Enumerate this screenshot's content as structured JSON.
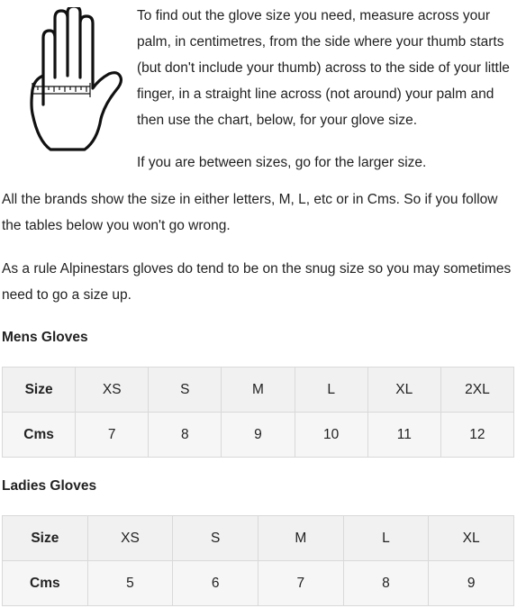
{
  "intro": {
    "paragraph1": "To find out the glove size you need, measure across your palm, in centimetres, from the side where your thumb starts (but don't include your thumb) across to the side of your little finger, in a straight line across (not around) your palm and then use the chart, below, for your glove size.",
    "paragraph2": "If you are between sizes, go for the larger size.",
    "icon": "hand-measure-icon"
  },
  "body": {
    "paragraph3": "All the brands show the size in either letters, M, L, etc or in Cms. So if you follow the tables below you won't go wrong.",
    "paragraph4": "As a rule Alpinestars gloves do tend to be on the snug size so you may sometimes need to go a size up."
  },
  "mens": {
    "heading": "Mens Gloves",
    "size_label": "Size",
    "cms_label": "Cms",
    "sizes": [
      "XS",
      "S",
      "M",
      "L",
      "XL",
      "2XL"
    ],
    "cms": [
      "7",
      "8",
      "9",
      "10",
      "11",
      "12"
    ]
  },
  "ladies": {
    "heading": "Ladies Gloves",
    "size_label": "Size",
    "cms_label": "Cms",
    "sizes": [
      "XS",
      "S",
      "M",
      "L",
      "XL"
    ],
    "cms": [
      "5",
      "6",
      "7",
      "8",
      "9"
    ]
  }
}
